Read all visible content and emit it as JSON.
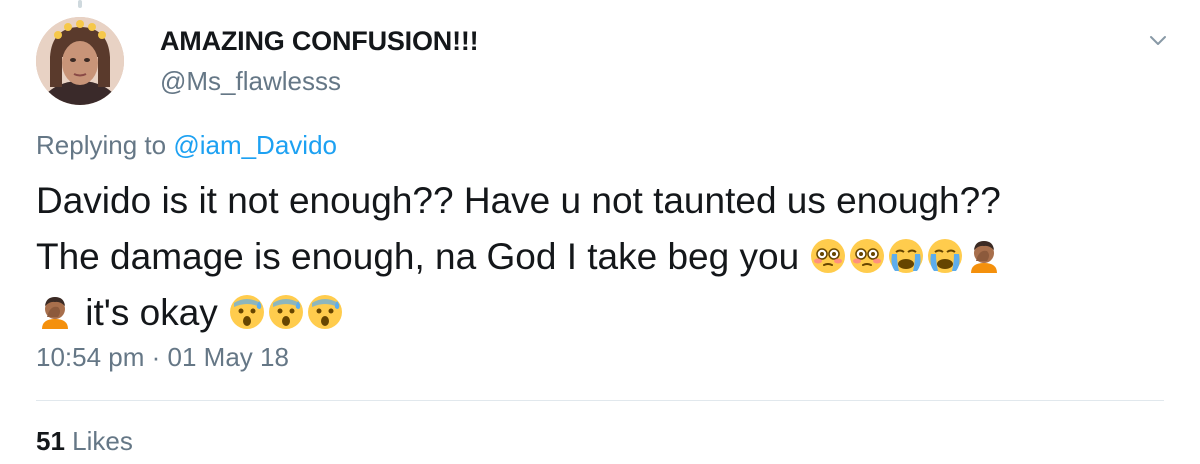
{
  "tweet": {
    "display_name": "AMAZING CONFUSION!!!",
    "handle": "@Ms_flawlesss",
    "replying_prefix": "Replying to",
    "replying_to": "@iam_Davido",
    "line1": "Davido is it not enough?? Have u not taunted us enough??",
    "line2_text": "The damage is enough, na God I take beg you",
    "line3_text": "it's okay",
    "timestamp": "10:54 pm · 01 May 18",
    "likes_count": "51",
    "likes_label": "Likes"
  },
  "icons": {
    "caret": "chevron-down-icon",
    "emojis_line2": [
      "flushed-face",
      "flushed-face",
      "crying-face",
      "crying-face",
      "facepalm"
    ],
    "emojis_line3_leading": "facepalm",
    "emojis_line3_trailing": [
      "anxious-sweat-face",
      "anxious-sweat-face",
      "anxious-sweat-face"
    ]
  },
  "colors": {
    "text": "#14171a",
    "secondary": "#657786",
    "link": "#1da1f2",
    "divider": "#e1e8ed"
  }
}
